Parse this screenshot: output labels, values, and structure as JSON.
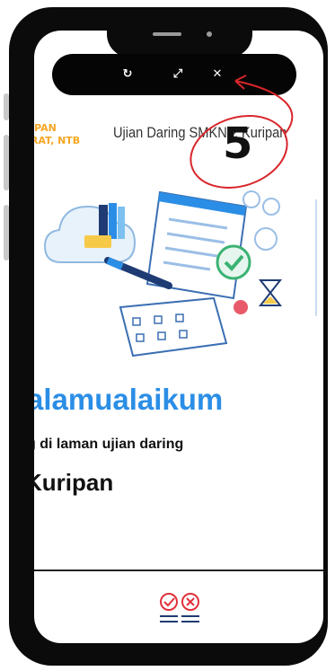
{
  "toolbar": {
    "buttons": [
      {
        "name": "refresh",
        "glyph": "↻"
      },
      {
        "name": "expand",
        "glyph": "⤢"
      },
      {
        "name": "close",
        "glyph": "✕"
      }
    ]
  },
  "header": {
    "school_name": "IPAN\nRAT, NTB",
    "site_title": "Ujian Daring SMKN 2 Kuripan"
  },
  "main": {
    "greeting": "alamualaikum",
    "subtitle": "g di laman ujian daring",
    "school_heading": "Kuripan"
  },
  "annotation": {
    "step_number": "5",
    "color": "#d9262b"
  },
  "colors": {
    "accent_blue": "#2b8ee6",
    "logo_orange": "#f5a623",
    "frame": "#0b0b0b"
  }
}
